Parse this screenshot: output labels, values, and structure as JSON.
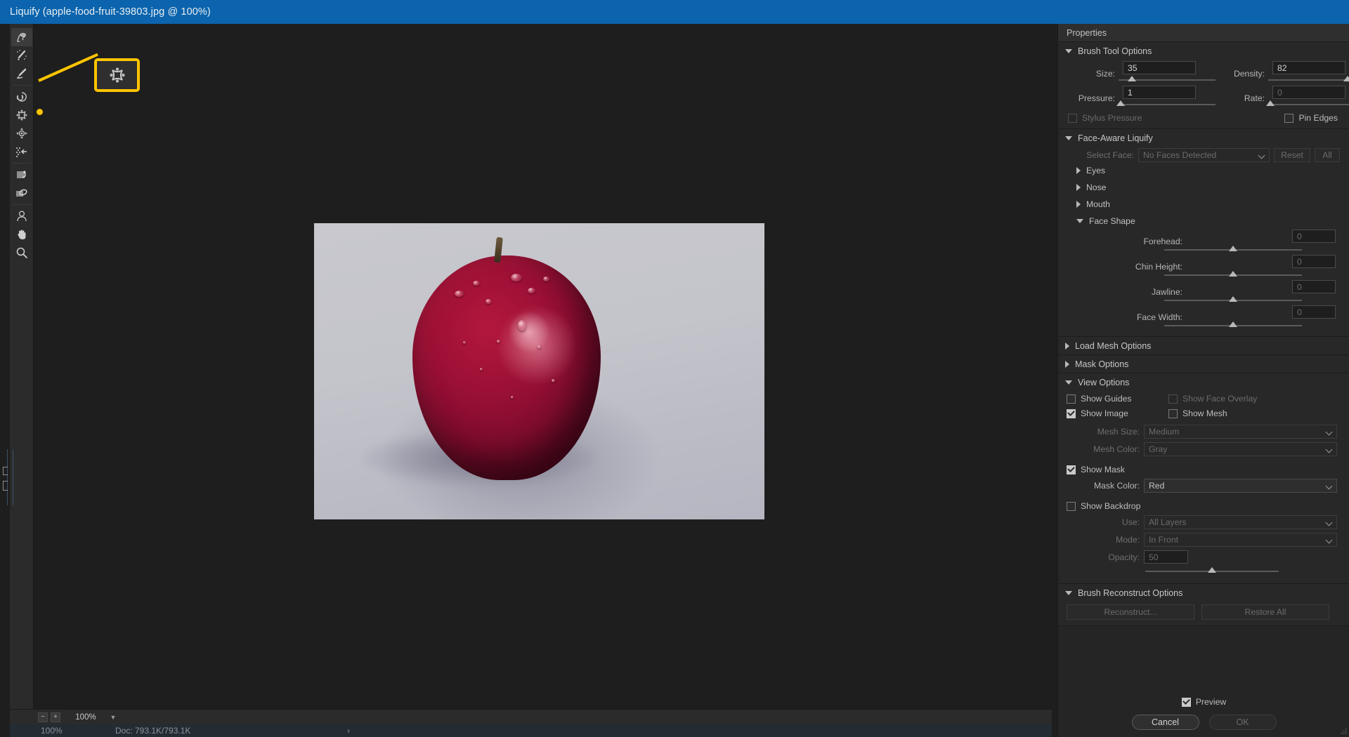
{
  "window": {
    "title": "Liquify (apple-food-fruit-39803.jpg @ 100%)"
  },
  "toolbar": {
    "tools": [
      {
        "name": "forward-warp-tool",
        "label": "Forward Warp Tool",
        "selected": true
      },
      {
        "name": "reconstruct-tool",
        "label": "Reconstruct Tool",
        "selected": false
      },
      {
        "name": "smooth-tool",
        "label": "Smooth Tool",
        "selected": false
      },
      {
        "name": "twirl-clockwise-tool",
        "label": "Twirl Clockwise Tool",
        "selected": false
      },
      {
        "name": "pucker-tool",
        "label": "Pucker Tool",
        "selected": false
      },
      {
        "name": "bloat-tool",
        "label": "Bloat Tool",
        "selected": false
      },
      {
        "name": "push-left-tool",
        "label": "Push Left Tool",
        "selected": false
      },
      {
        "name": "freeze-mask-tool",
        "label": "Freeze Mask Tool",
        "selected": false
      },
      {
        "name": "thaw-mask-tool",
        "label": "Thaw Mask Tool",
        "selected": false
      },
      {
        "name": "face-tool",
        "label": "Face Tool",
        "selected": false
      },
      {
        "name": "hand-tool",
        "label": "Hand Tool",
        "selected": false
      },
      {
        "name": "zoom-tool",
        "label": "Zoom Tool",
        "selected": false
      }
    ]
  },
  "callout": {
    "highlighted_tool": "pucker-tool",
    "color": "#fdc500"
  },
  "statusbar": {
    "zoom_out": "−",
    "zoom_in": "+",
    "zoom_value": "100%",
    "under_zoom": "100%",
    "doc_info": "Doc: 793.1K/793.1K",
    "arrow": "›"
  },
  "properties": {
    "header": "Properties",
    "brush_tool_options": {
      "title": "Brush Tool Options",
      "expanded": true,
      "size": {
        "label": "Size:",
        "value": "35",
        "slider_pct": 14
      },
      "density": {
        "label": "Density:",
        "value": "82",
        "slider_pct": 82
      },
      "pressure": {
        "label": "Pressure:",
        "value": "1",
        "slider_pct": 1
      },
      "rate": {
        "label": "Rate:",
        "value": "0",
        "slider_pct": 0,
        "disabled": true
      },
      "stylus_pressure": {
        "label": "Stylus Pressure",
        "checked": false,
        "disabled": true
      },
      "pin_edges": {
        "label": "Pin Edges",
        "checked": false,
        "disabled": false
      }
    },
    "face_aware_liquify": {
      "title": "Face-Aware Liquify",
      "expanded": true,
      "select_face_label": "Select Face:",
      "select_face_value": "No Faces Detected",
      "reset_label": "Reset",
      "all_label": "All",
      "sub_eyes": "Eyes",
      "sub_nose": "Nose",
      "sub_mouth": "Mouth",
      "sub_face_shape": "Face Shape",
      "face_shape": [
        {
          "label": "Forehead:",
          "value": "0",
          "slider_pct": 50
        },
        {
          "label": "Chin Height:",
          "value": "0",
          "slider_pct": 50
        },
        {
          "label": "Jawline:",
          "value": "0",
          "slider_pct": 50
        },
        {
          "label": "Face Width:",
          "value": "0",
          "slider_pct": 50
        }
      ]
    },
    "load_mesh_options": {
      "title": "Load Mesh Options",
      "expanded": false
    },
    "mask_options": {
      "title": "Mask Options",
      "expanded": false
    },
    "view_options": {
      "title": "View Options",
      "expanded": true,
      "show_guides": {
        "label": "Show Guides",
        "checked": false,
        "disabled": false
      },
      "show_face_overlay": {
        "label": "Show Face Overlay",
        "checked": false,
        "disabled": true
      },
      "show_image": {
        "label": "Show Image",
        "checked": true,
        "disabled": false
      },
      "show_mesh": {
        "label": "Show Mesh",
        "checked": false,
        "disabled": false
      },
      "mesh_size": {
        "label": "Mesh Size:",
        "value": "Medium",
        "disabled": true
      },
      "mesh_color": {
        "label": "Mesh Color:",
        "value": "Gray",
        "disabled": true
      },
      "show_mask": {
        "label": "Show Mask",
        "checked": true,
        "disabled": false
      },
      "mask_color": {
        "label": "Mask Color:",
        "value": "Red",
        "disabled": false
      },
      "show_backdrop": {
        "label": "Show Backdrop",
        "checked": false,
        "disabled": false
      },
      "use": {
        "label": "Use:",
        "value": "All Layers",
        "disabled": true
      },
      "mode": {
        "label": "Mode:",
        "value": "In Front",
        "disabled": true
      },
      "opacity": {
        "label": "Opacity:",
        "value": "50",
        "slider_pct": 50,
        "disabled": true
      }
    },
    "brush_reconstruct_options": {
      "title": "Brush Reconstruct Options",
      "expanded": true,
      "reconstruct_label": "Reconstruct...",
      "restore_all_label": "Restore All"
    },
    "footer": {
      "preview_label": "Preview",
      "preview_checked": true,
      "cancel_label": "Cancel",
      "ok_label": "OK",
      "ok_disabled": true
    }
  },
  "canvas": {
    "image_alt": "red apple with water droplets on gray background"
  }
}
